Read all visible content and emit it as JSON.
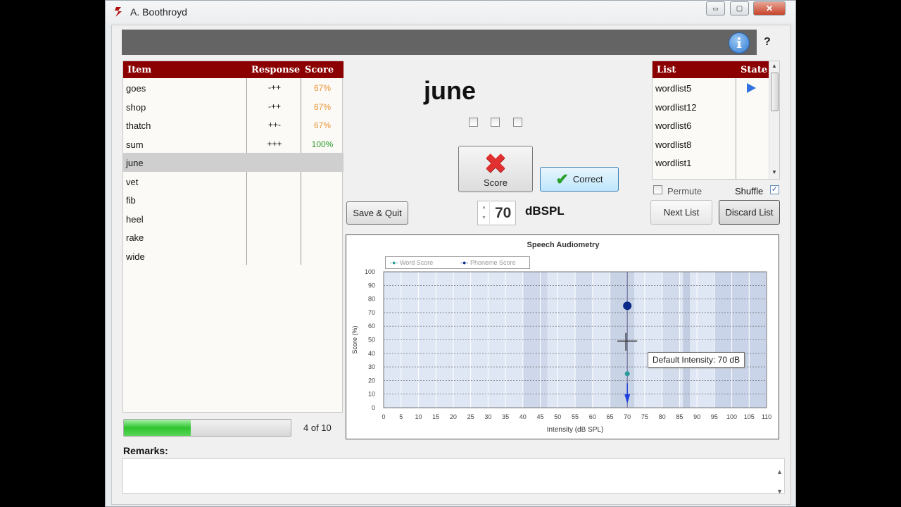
{
  "window": {
    "title": "A. Boothroyd",
    "minimize": "▭",
    "maximize": "▢",
    "close": "✕"
  },
  "toolbar": {
    "info_icon": "i",
    "help_label": "?"
  },
  "items": {
    "headers": {
      "item": "Item",
      "response": "Response",
      "score": "Score"
    },
    "rows": [
      {
        "item": "goes",
        "response": "-++",
        "score": "67%"
      },
      {
        "item": "shop",
        "response": "-++",
        "score": "67%"
      },
      {
        "item": "thatch",
        "response": "++-",
        "score": "67%"
      },
      {
        "item": "sum",
        "response": "+++",
        "score": "100%"
      },
      {
        "item": "june",
        "response": "",
        "score": ""
      },
      {
        "item": "vet",
        "response": "",
        "score": ""
      },
      {
        "item": "fib",
        "response": "",
        "score": ""
      },
      {
        "item": "heel",
        "response": "",
        "score": ""
      },
      {
        "item": "rake",
        "response": "",
        "score": ""
      },
      {
        "item": "wide",
        "response": "",
        "score": ""
      }
    ],
    "score_color_partial": "#e8953a",
    "score_color_full": "#2a9a2a"
  },
  "progress": {
    "label": "4 of 10",
    "fraction": 0.4
  },
  "current_word": "june",
  "buttons": {
    "score": "Score",
    "correct": "Correct",
    "save_quit": "Save & Quit",
    "next_list": "Next List",
    "discard_list": "Discard List"
  },
  "intensity": {
    "value": "70",
    "unit": "dBSPL"
  },
  "lists": {
    "headers": {
      "list": "List",
      "state": "State"
    },
    "rows": [
      "wordlist5",
      "wordlist12",
      "wordlist6",
      "wordlist8",
      "wordlist1"
    ],
    "permute_label": "Permute",
    "shuffle_label": "Shuffle",
    "shuffle_checked": "✓"
  },
  "remarks": {
    "label": "Remarks:",
    "value": ""
  },
  "chart_data": {
    "type": "scatter",
    "title": "Speech Audiometry",
    "xlabel": "Intensity (dB SPL)",
    "ylabel": "Score (%)",
    "xlim": [
      0,
      110
    ],
    "ylim": [
      0,
      100
    ],
    "xticks": [
      0,
      5,
      10,
      15,
      20,
      25,
      30,
      35,
      40,
      45,
      50,
      55,
      60,
      65,
      70,
      75,
      80,
      85,
      90,
      95,
      100,
      105,
      110
    ],
    "yticks": [
      0,
      10,
      20,
      30,
      40,
      50,
      60,
      70,
      80,
      90,
      100
    ],
    "grid": true,
    "legend_position": "top-left",
    "series": [
      {
        "name": "Word Score",
        "color": "#2a9a9a",
        "x": [
          70
        ],
        "y": [
          25
        ]
      },
      {
        "name": "Phoneme Score",
        "color": "#0a2a8a",
        "x": [
          70
        ],
        "y": [
          75
        ]
      }
    ],
    "tooltip": "Default Intensity: 70 dB",
    "default_intensity": 70
  }
}
